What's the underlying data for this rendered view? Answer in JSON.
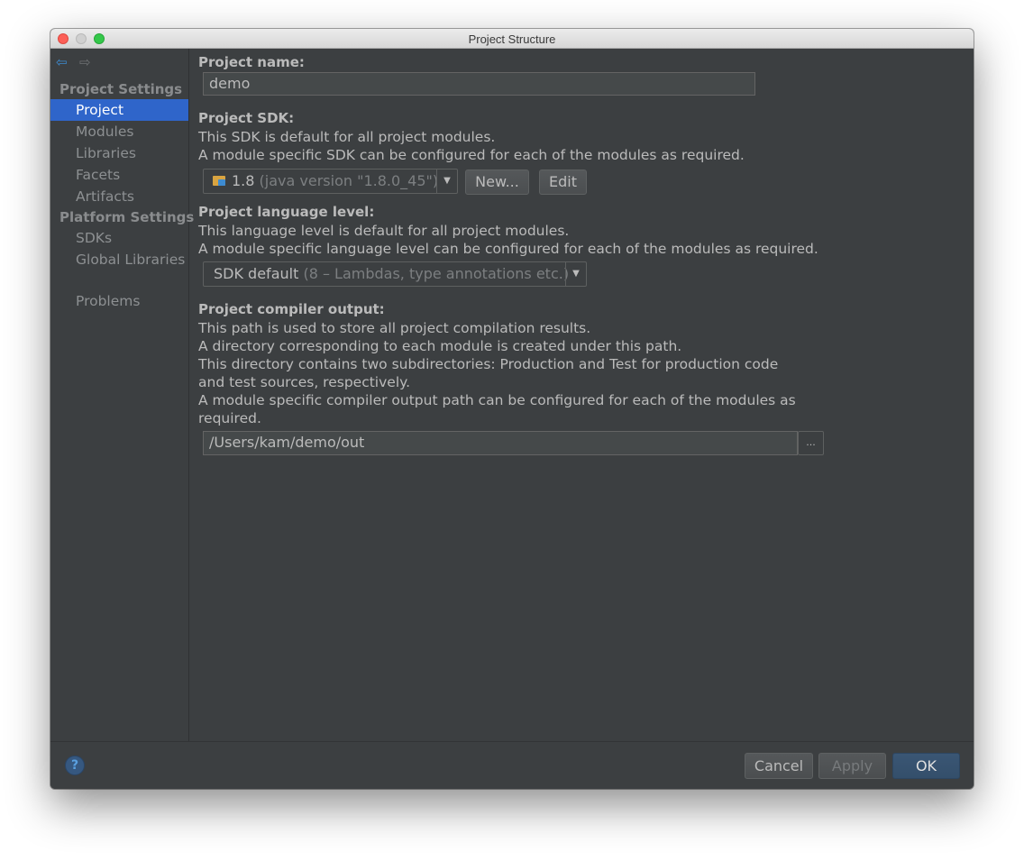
{
  "window": {
    "title": "Project Structure"
  },
  "sidebar": {
    "project_settings_header": "Project Settings",
    "platform_settings_header": "Platform Settings",
    "items": [
      {
        "label": "Project",
        "selected": true
      },
      {
        "label": "Modules"
      },
      {
        "label": "Libraries"
      },
      {
        "label": "Facets"
      },
      {
        "label": "Artifacts"
      },
      {
        "label": "SDKs"
      },
      {
        "label": "Global Libraries"
      },
      {
        "label": "Problems"
      }
    ],
    "back_icon": "arrow-left-icon",
    "forward_icon": "arrow-right-icon"
  },
  "content": {
    "project_name_label": "Project name:",
    "project_name_value": "demo",
    "sdk_label": "Project SDK:",
    "sdk_desc_1": "This SDK is default for all project modules.",
    "sdk_desc_2": "A module specific SDK can be configured for each of the modules as required.",
    "sdk_value": "1.8",
    "sdk_value_detail": "(java version \"1.8.0_45\")",
    "sdk_new_button": "New...",
    "sdk_edit_button": "Edit",
    "lang_label": "Project language level:",
    "lang_desc_1": "This language level is default for all project modules.",
    "lang_desc_2": "A module specific language level can be configured for each of the modules as required.",
    "lang_value": "SDK default",
    "lang_value_detail": "(8 – Lambdas, type annotations etc.)",
    "output_label": "Project compiler output:",
    "output_desc": [
      "This path is used to store all project compilation results.",
      "A directory corresponding to each module is created under this path.",
      "This directory contains two subdirectories: Production and Test for production code",
      "and test sources, respectively.",
      "A module specific compiler output path can be configured for each of the modules as",
      "required."
    ],
    "output_path": "/Users/kam/demo/out",
    "browse_label": "..."
  },
  "footer": {
    "help_label": "?",
    "cancel_button": "Cancel",
    "apply_button": "Apply",
    "ok_button": "OK"
  },
  "colors": {
    "background": "#3c3f41",
    "selection": "#2f65ca",
    "text": "#bbbbbb",
    "default_button": "#365880"
  }
}
